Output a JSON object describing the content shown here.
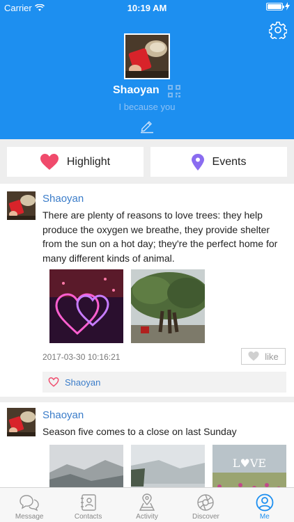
{
  "status_bar": {
    "carrier": "Carrier",
    "time": "10:19 AM"
  },
  "profile": {
    "name": "Shaoyan",
    "signature": "I because you"
  },
  "actions": [
    {
      "label": "Highlight",
      "icon": "heart-icon"
    },
    {
      "label": "Events",
      "icon": "location-pin-icon"
    }
  ],
  "posts": [
    {
      "user": "Shaoyan",
      "text": "There are plenty of reasons to love trees: they help produce the oxygen we breathe, they provide shelter from the sun on a hot day; they're the perfect home for many different kinds of animal.",
      "time": "2017-03-30 10:16:21",
      "like_label": "like",
      "liked_by": "Shaoyan"
    },
    {
      "user": "Shaoyan",
      "text": "Season five comes to a close on last Sunday",
      "image3_text": "L♥VE"
    }
  ],
  "tabs": [
    {
      "label": "Message",
      "icon": "message-icon"
    },
    {
      "label": "Contacts",
      "icon": "contacts-icon"
    },
    {
      "label": "Activity",
      "icon": "activity-icon"
    },
    {
      "label": "Discover",
      "icon": "discover-icon"
    },
    {
      "label": "Me",
      "icon": "me-icon",
      "active": true
    }
  ],
  "colors": {
    "accent": "#1d8ff0",
    "link": "#3a7cc9",
    "heart": "#f04b6c",
    "pin": "#8a6cf0"
  }
}
